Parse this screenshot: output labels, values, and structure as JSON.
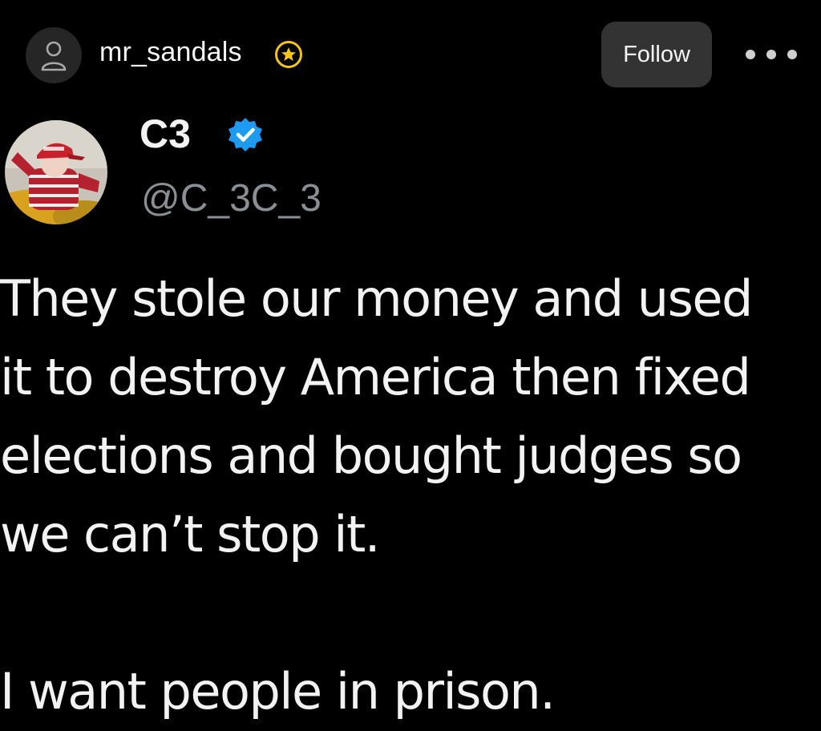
{
  "post_header": {
    "username": "mr_sandals",
    "follow_label": "Follow",
    "badge_icon": "star-badge-icon",
    "more_icon": "ellipsis-icon"
  },
  "tweet": {
    "display_name": "C3",
    "handle": "@C_3C_3",
    "verified_icon": "verified-check-icon",
    "verified_color": "#1d9bf0",
    "body_lines": [
      "They stole our money and used",
      "it to destroy America then fixed",
      "elections and bought judges so",
      "we can’t stop it."
    ],
    "closing_line": "I want people in prison."
  },
  "colors": {
    "background": "#000000",
    "text": "#f2f2f2",
    "handle": "#8a8f94",
    "follow_button": "#333333",
    "badge_yellow": "#f5c518"
  }
}
